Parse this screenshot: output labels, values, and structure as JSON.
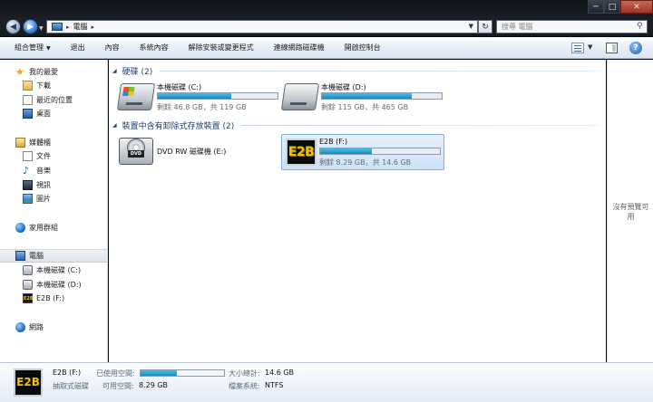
{
  "window": {
    "minimize": "─",
    "maximize": "□",
    "close": "✕"
  },
  "address": {
    "crumb": "電腦",
    "separator": "▸",
    "separator_end": "▸",
    "search_placeholder": "搜尋 電腦"
  },
  "toolbar": {
    "items": [
      "組合管理",
      "退出",
      "內容",
      "系統內容",
      "解除安裝或變更程式",
      "連線網路磁碟機",
      "開啟控制台"
    ]
  },
  "nav": {
    "favorites": "我的最愛",
    "downloads": "下載",
    "recent": "最近的位置",
    "desktop": "桌面",
    "libraries": "媒體櫃",
    "documents": "文件",
    "music": "音樂",
    "videos": "視訊",
    "pictures": "圖片",
    "homegroup": "家用群組",
    "computer": "電腦",
    "drive_c": "本機磁碟 (C:)",
    "drive_d": "本機磁碟 (D:)",
    "drive_f": "E2B (F:)",
    "network": "網路"
  },
  "content": {
    "hdd_group": "硬碟 (2)",
    "removable_group": "裝置中含有卸除式存放裝置 (2)",
    "drives": {
      "c": {
        "name": "本機磁碟 (C:)",
        "free": "剩餘 46.8 GB，共 119 GB",
        "used_fraction": 0.61
      },
      "d": {
        "name": "本機磁碟 (D:)",
        "free": "剩餘 115 GB，共 465 GB",
        "used_fraction": 0.75
      },
      "e": {
        "name": "DVD RW 磁碟機 (E:)"
      },
      "f": {
        "name": "E2B (F:)",
        "free": "剩餘 8.29 GB，共 14.6 GB",
        "used_fraction": 0.43
      }
    }
  },
  "preview": {
    "no_preview": "沒有預覽可用"
  },
  "details": {
    "name": "E2B (F:)",
    "type": "抽取式磁碟",
    "used_label": "已使用空間:",
    "free_label": "可用空間:",
    "free_value": "8.29 GB",
    "total_label": "大小總計:",
    "total_value": "14.6 GB",
    "fs_label": "檔案系統:",
    "fs_value": "NTFS",
    "used_fraction": 0.43,
    "icon_text": "E2B"
  },
  "icons": {
    "e2b_text": "E2B",
    "dvd_text": "DVD"
  }
}
